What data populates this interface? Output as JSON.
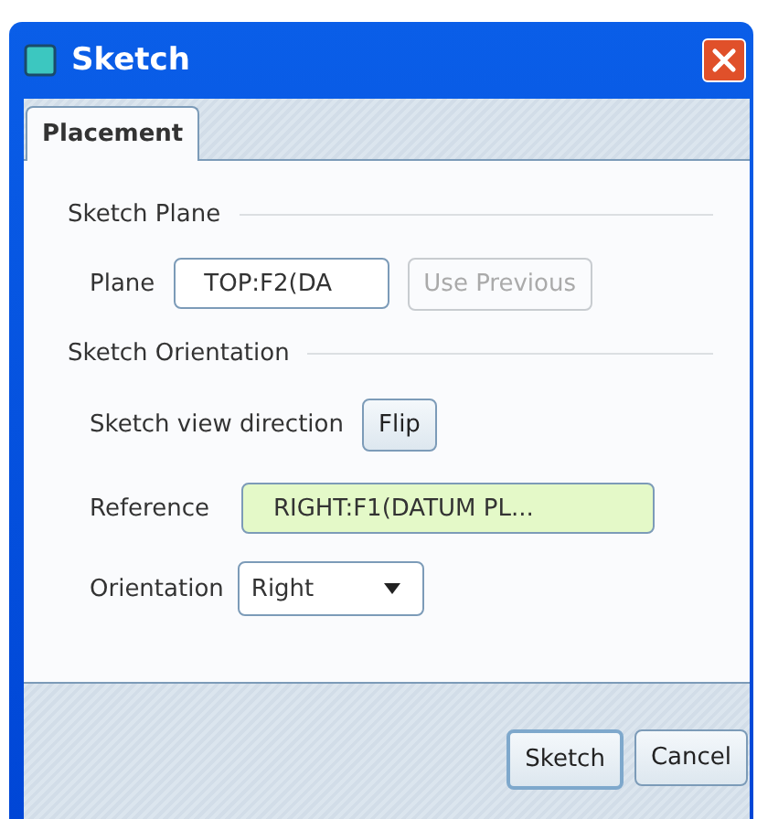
{
  "window": {
    "title": "Sketch"
  },
  "tabs": [
    {
      "label": "Placement",
      "selected": true
    }
  ],
  "sketch_plane": {
    "heading": "Sketch Plane",
    "label": "Plane",
    "value": "TOP:F2(DA",
    "use_previous": {
      "label": "Use Previous",
      "disabled": true
    }
  },
  "sketch_orientation": {
    "heading": "Sketch Orientation",
    "view_direction_label": "Sketch view direction",
    "flip_button": "Flip",
    "reference_label": "Reference",
    "reference_value": "RIGHT:F1(DATUM PL...",
    "reference_highlighted": true,
    "orientation_label": "Orientation",
    "orientation_value": "Right"
  },
  "buttons": [
    {
      "label": "Sketch",
      "default": true
    },
    {
      "label": "Cancel",
      "default": false
    }
  ]
}
